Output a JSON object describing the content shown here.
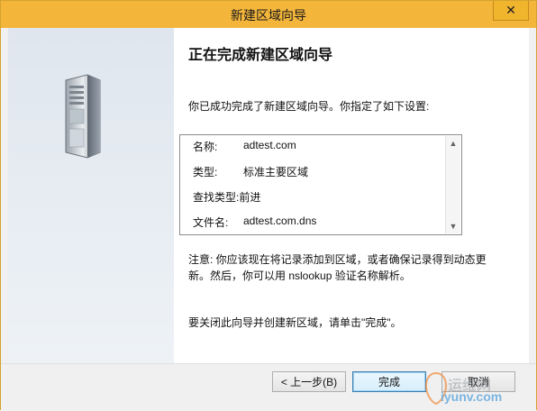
{
  "window": {
    "title": "新建区域向导",
    "close_glyph": "✕"
  },
  "heading": "正在完成新建区域向导",
  "intro": "你已成功完成了新建区域向导。你指定了如下设置:",
  "summary": [
    {
      "label": "名称:",
      "value": "adtest.com"
    },
    {
      "label": "类型:",
      "value": "标准主要区域"
    },
    {
      "label": "查找类型:",
      "value": "前进"
    },
    {
      "label": "文件名:",
      "value": "adtest.com.dns"
    }
  ],
  "note": "注意: 你应该现在将记录添加到区域，或者确保记录得到动态更新。然后，你可以用 nslookup 验证名称解析。",
  "closing": "要关闭此向导并创建新区域，请单击\"完成\"。",
  "buttons": {
    "back": "< 上一步(B)",
    "finish": "完成",
    "cancel": "取消"
  },
  "watermark": {
    "text": "运维网",
    "url": "iyunv.com"
  },
  "icons": {
    "server": "server-icon",
    "scroll_up": "▲",
    "scroll_down": "▼"
  },
  "colors": {
    "titlebar": "#f4b63a",
    "accent_button": "#3c7fb1"
  }
}
